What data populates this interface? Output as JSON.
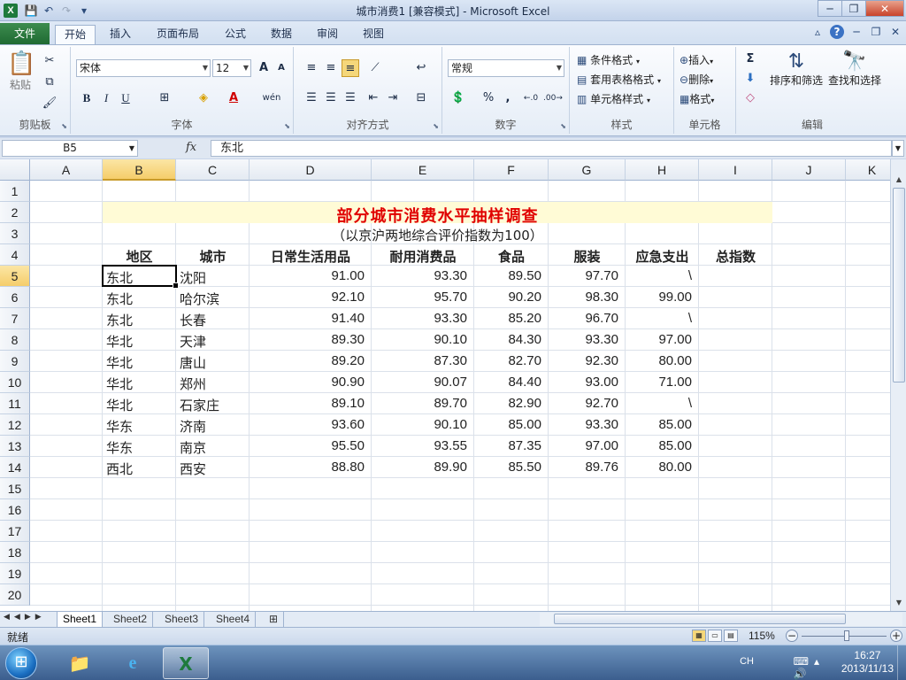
{
  "window": {
    "title": "城市消费1  [兼容模式] - Microsoft Excel",
    "app_icon": "excel-icon"
  },
  "ribbon_tabs": [
    "文件",
    "开始",
    "插入",
    "页面布局",
    "公式",
    "数据",
    "审阅",
    "视图"
  ],
  "active_tab": "开始",
  "ribbon": {
    "clipboard": {
      "label": "剪贴板",
      "paste": "粘贴"
    },
    "font": {
      "label": "字体",
      "font_name": "宋体",
      "font_size": "12",
      "bold": "B",
      "italic": "I",
      "underline": "U",
      "grow": "A",
      "shrink": "A",
      "font_color": "A",
      "wen": "wén"
    },
    "alignment": {
      "label": "对齐方式"
    },
    "number": {
      "label": "数字",
      "format": "常规",
      "percent": "%",
      "comma": ",",
      "inc_dec": ".0 .00",
      "dec_dec": ".00 .0"
    },
    "styles": {
      "label": "样式",
      "cond_format": "条件格式",
      "table_format": "套用表格格式",
      "cell_styles": "单元格样式"
    },
    "cells": {
      "label": "单元格",
      "insert": "插入",
      "delete": "删除",
      "format": "格式"
    },
    "editing": {
      "label": "编辑",
      "sort_filter": "排序和筛选",
      "find_select": "查找和选择",
      "sigma": "Σ"
    }
  },
  "formula_bar": {
    "name_box": "B5",
    "fx": "fx",
    "value": "东北"
  },
  "columns": [
    "A",
    "B",
    "C",
    "D",
    "E",
    "F",
    "G",
    "H",
    "I",
    "J",
    "K"
  ],
  "rows": [
    "1",
    "2",
    "3",
    "4",
    "5",
    "6",
    "7",
    "8",
    "9",
    "10",
    "11",
    "12",
    "13",
    "14",
    "15",
    "16",
    "17",
    "18",
    "19",
    "20"
  ],
  "selected": {
    "col": "B",
    "row": "5"
  },
  "sheet": {
    "title": "部分城市消费水平抽样调查",
    "subtitle": "（以京沪两地综合评价指数为100）",
    "headers": [
      "地区",
      "城市",
      "日常生活用品",
      "耐用消费品",
      "食品",
      "服装",
      "应急支出",
      "总指数"
    ],
    "data": [
      [
        "东北",
        "沈阳",
        "91.00",
        "93.30",
        "89.50",
        "97.70",
        "\\",
        ""
      ],
      [
        "东北",
        "哈尔滨",
        "92.10",
        "95.70",
        "90.20",
        "98.30",
        "99.00",
        ""
      ],
      [
        "东北",
        "长春",
        "91.40",
        "93.30",
        "85.20",
        "96.70",
        "\\",
        ""
      ],
      [
        "华北",
        "天津",
        "89.30",
        "90.10",
        "84.30",
        "93.30",
        "97.00",
        ""
      ],
      [
        "华北",
        "唐山",
        "89.20",
        "87.30",
        "82.70",
        "92.30",
        "80.00",
        ""
      ],
      [
        "华北",
        "郑州",
        "90.90",
        "90.07",
        "84.40",
        "93.00",
        "71.00",
        ""
      ],
      [
        "华北",
        "石家庄",
        "89.10",
        "89.70",
        "82.90",
        "92.70",
        "\\",
        ""
      ],
      [
        "华东",
        "济南",
        "93.60",
        "90.10",
        "85.00",
        "93.30",
        "85.00",
        ""
      ],
      [
        "华东",
        "南京",
        "95.50",
        "93.55",
        "87.35",
        "97.00",
        "85.00",
        ""
      ],
      [
        "西北",
        "西安",
        "88.80",
        "89.90",
        "85.50",
        "89.76",
        "80.00",
        ""
      ]
    ]
  },
  "sheet_tabs": [
    "Sheet1",
    "Sheet2",
    "Sheet3",
    "Sheet4"
  ],
  "active_sheet": "Sheet1",
  "status": {
    "ready": "就绪",
    "zoom": "115%"
  },
  "taskbar": {
    "lang": "CH",
    "time": "16:27",
    "date": "2013/11/13"
  }
}
